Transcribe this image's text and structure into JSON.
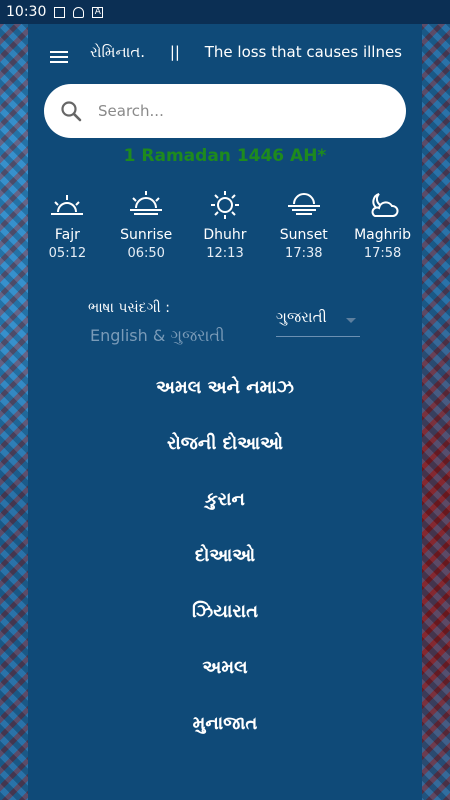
{
  "status_bar": {
    "time": "10:30",
    "icons": [
      "image-icon",
      "bell-icon",
      "a-icon"
    ]
  },
  "header": {
    "ticker_text": "રોમિનાત.",
    "ticker_separator": "||",
    "ticker_text2": "The loss that causes illnes"
  },
  "search": {
    "placeholder": "Search..."
  },
  "hijri_date": "1 Ramadan 1446 AH*",
  "prayers": [
    {
      "name": "Fajr",
      "time": "05:12",
      "icon": "sunrise-horizon-icon"
    },
    {
      "name": "Sunrise",
      "time": "06:50",
      "icon": "sunrise-icon"
    },
    {
      "name": "Dhuhr",
      "time": "12:13",
      "icon": "sun-icon"
    },
    {
      "name": "Sunset",
      "time": "17:38",
      "icon": "sunset-icon"
    },
    {
      "name": "Maghrib",
      "time": "17:58",
      "icon": "cloud-moon-icon"
    }
  ],
  "language": {
    "label": "ભાષા પસંદગી :",
    "sub": "English & ગુજરાતી",
    "selected": "ગુજરાતી"
  },
  "menu_items": [
    "અમલ અને નમાઝ",
    "રોજની દોઆઓ",
    "કુરાન",
    "દોઆઓ",
    "ઝિયારાત",
    "અમલ",
    "મુનાજાત"
  ],
  "colors": {
    "panel": "#0f4a78",
    "hijri": "#1e8a1e"
  }
}
